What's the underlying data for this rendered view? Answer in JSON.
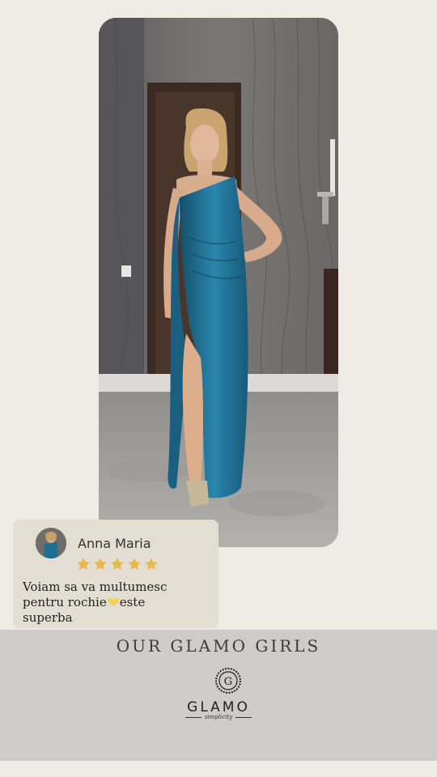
{
  "review": {
    "name": "Anna Maria",
    "rating": 5,
    "text_before": "Voiam sa va multumesc pentru rochie",
    "text_after": "este superba"
  },
  "footer": {
    "title": "OUR GLAMO GIRLS",
    "brand": "GLAMO",
    "tagline": "simplicity",
    "emblem_letter": "G"
  },
  "colors": {
    "background": "#efece6",
    "band": "#cfcbcb",
    "review_card": "#e4ded2",
    "star": "#e8b84a",
    "dress": "#1f6f92"
  }
}
